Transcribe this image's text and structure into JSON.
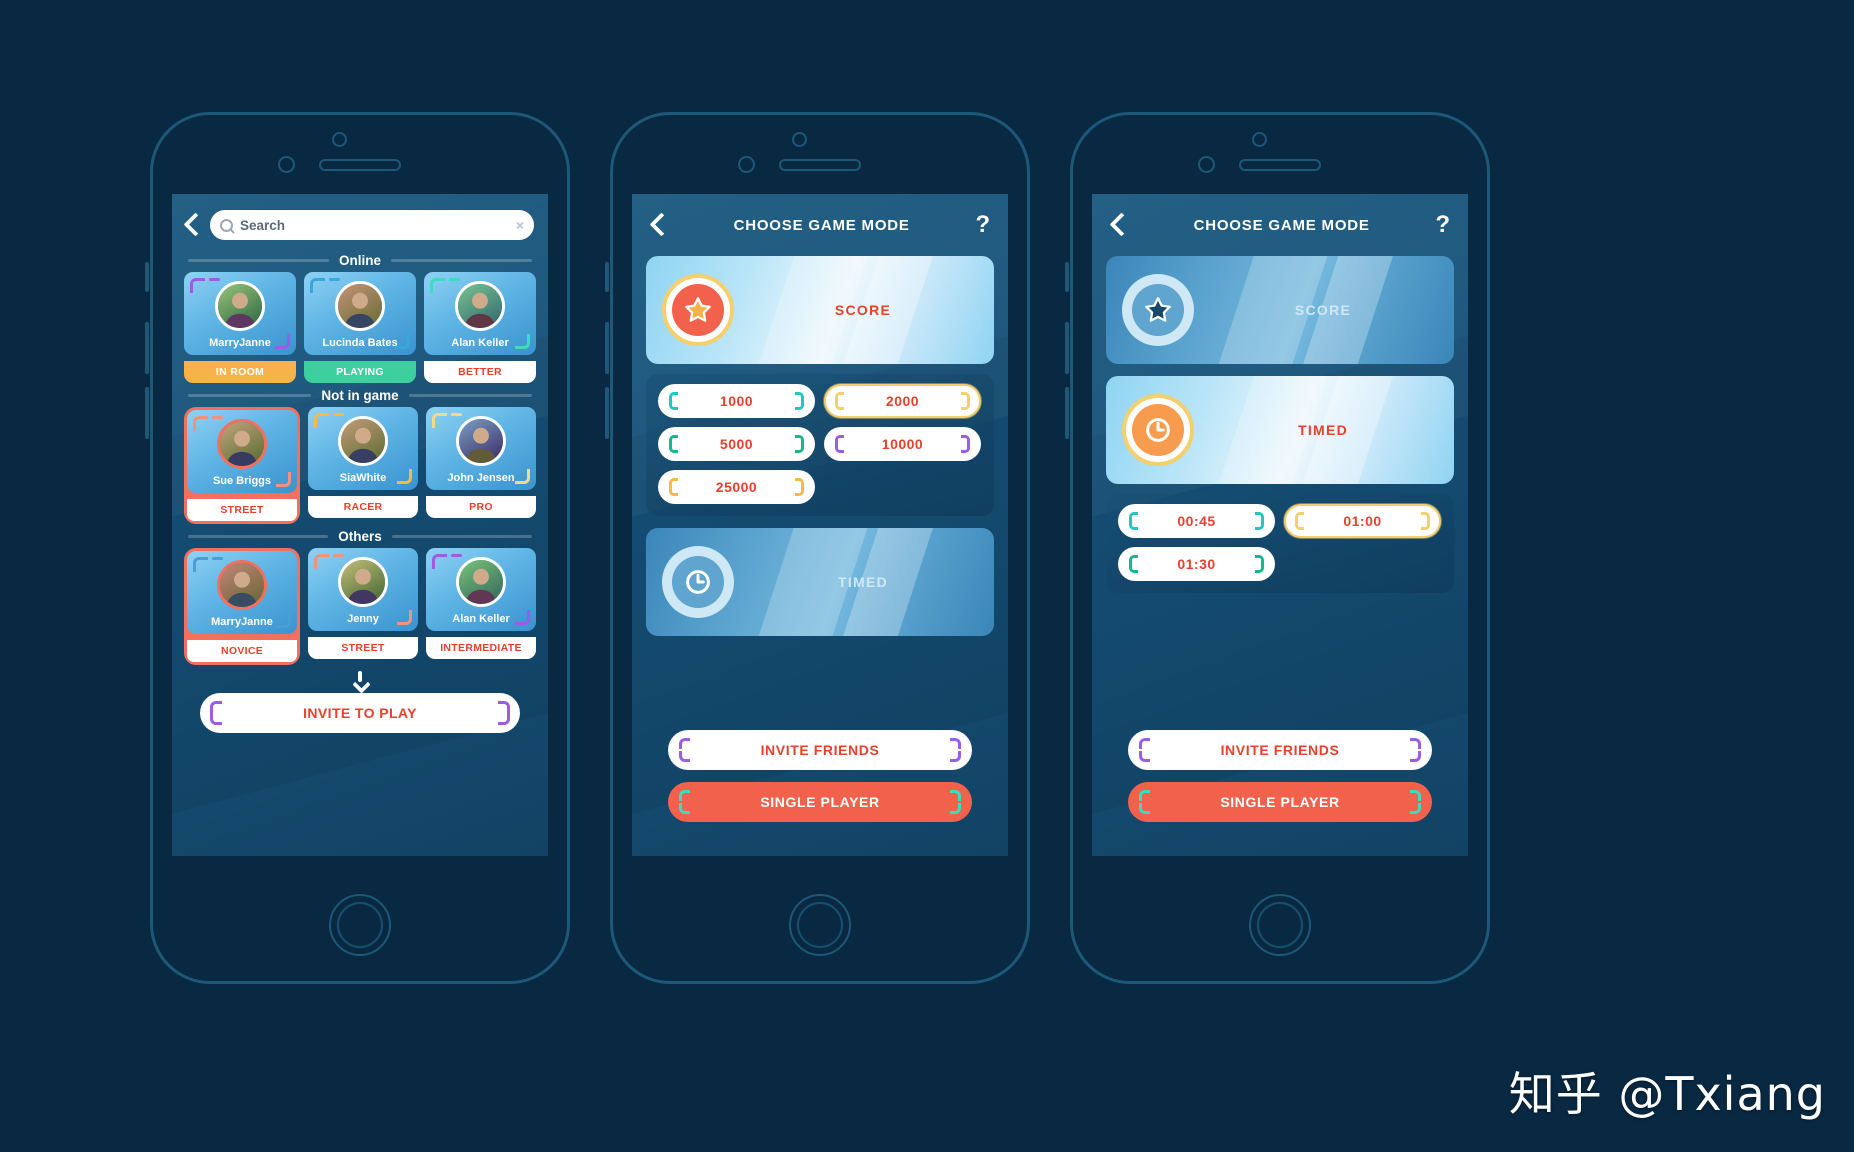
{
  "watermark": "知乎 @Txiang",
  "colors": {
    "accent_red": "#e8402c",
    "coral": "#f2614c",
    "gold": "#f4cf6b",
    "orange_badge": "#f7b24a",
    "teal_badge": "#3ecf9e",
    "screen_bg": "#17527a",
    "frame": "#1d5878",
    "page_bg": "#092942"
  },
  "phone1": {
    "name": "friends-list-screen",
    "search": {
      "placeholder": "Search",
      "value": "",
      "clear_label": "×"
    },
    "sections": [
      {
        "title": "Online",
        "players": [
          {
            "name": "MarryJanne",
            "status": "IN ROOM",
            "status_bg": "#f7b24a",
            "status_color": "#ffffff",
            "corner": "#9b5de5",
            "selected": false,
            "avatar_hue": 95
          },
          {
            "name": "Lucinda Bates",
            "status": "PLAYING",
            "status_bg": "#3ecf9e",
            "status_color": "#ffffff",
            "corner": "#3aa7d9",
            "selected": false,
            "avatar_hue": 20
          },
          {
            "name": "Alan Keller",
            "status": "BETTER",
            "status_bg": "#ffffff",
            "status_color": "#e8402c",
            "corner": "#3ddbc0",
            "selected": false,
            "avatar_hue": 140
          }
        ]
      },
      {
        "title": "Not in game",
        "players": [
          {
            "name": "Sue Briggs",
            "status": "STREET",
            "status_bg": "#ffffff",
            "status_color": "#e8402c",
            "corner": "#f4907f",
            "selected": true,
            "avatar_hue": 35
          },
          {
            "name": "SiaWhite",
            "status": "RACER",
            "status_bg": "#ffffff",
            "status_color": "#e8402c",
            "corner": "#f5b946",
            "selected": false,
            "avatar_hue": 28
          },
          {
            "name": "John Jensen",
            "status": "PRO",
            "status_bg": "#ffffff",
            "status_color": "#e8402c",
            "corner": "#f5d98a",
            "selected": false,
            "avatar_hue": 210
          }
        ]
      },
      {
        "title": "Others",
        "players": [
          {
            "name": "MarryJanne",
            "status": "NOVICE",
            "status_bg": "#ffffff",
            "status_color": "#e8402c",
            "corner": "#4a9ed4",
            "selected": true,
            "avatar_hue": 10
          },
          {
            "name": "Jenny",
            "status": "STREET",
            "status_bg": "#ffffff",
            "status_color": "#e8402c",
            "corner": "#f4907f",
            "selected": false,
            "avatar_hue": 55
          },
          {
            "name": "Alan Keller",
            "status": "INTERMEDIATE",
            "status_bg": "#ffffff",
            "status_color": "#e8402c",
            "corner": "#9b5de5",
            "selected": false,
            "avatar_hue": 120
          }
        ]
      }
    ],
    "invite_button": {
      "label": "INVITE TO PLAY",
      "corner": "#9b5de5"
    }
  },
  "phone2": {
    "name": "choose-game-mode-score",
    "title": "CHOOSE GAME MODE",
    "help_label": "?",
    "score_mode": {
      "label": "SCORE",
      "active": true,
      "icon": "star-icon"
    },
    "score_options": [
      {
        "label": "1000",
        "corner": "#1fc9c0",
        "selected": false
      },
      {
        "label": "2000",
        "corner": "#f4cf6b",
        "selected": true
      },
      {
        "label": "5000",
        "corner": "#16b88b",
        "selected": false
      },
      {
        "label": "10000",
        "corner": "#9b5de5",
        "selected": false
      },
      {
        "label": "25000",
        "corner": "#f5b946",
        "selected": false
      }
    ],
    "timed_mode": {
      "label": "TIMED",
      "active": false,
      "icon": "clock-icon"
    },
    "buttons": [
      {
        "label": "INVITE FRIENDS",
        "style": "white",
        "corner": "#9b5de5"
      },
      {
        "label": "SINGLE PLAYER",
        "style": "red",
        "corner": "#3ddbc0"
      }
    ]
  },
  "phone3": {
    "name": "choose-game-mode-timed",
    "title": "CHOOSE GAME MODE",
    "help_label": "?",
    "score_mode": {
      "label": "SCORE",
      "active": false,
      "icon": "star-icon"
    },
    "timed_mode": {
      "label": "TIMED",
      "active": true,
      "icon": "clock-icon"
    },
    "timed_options": [
      {
        "label": "00:45",
        "corner": "#1fc9c0",
        "selected": false
      },
      {
        "label": "01:00",
        "corner": "#f4cf6b",
        "selected": true
      },
      {
        "label": "01:30",
        "corner": "#16b88b",
        "selected": false
      }
    ],
    "buttons": [
      {
        "label": "INVITE FRIENDS",
        "style": "white",
        "corner": "#9b5de5"
      },
      {
        "label": "SINGLE PLAYER",
        "style": "red",
        "corner": "#3ddbc0"
      }
    ]
  }
}
